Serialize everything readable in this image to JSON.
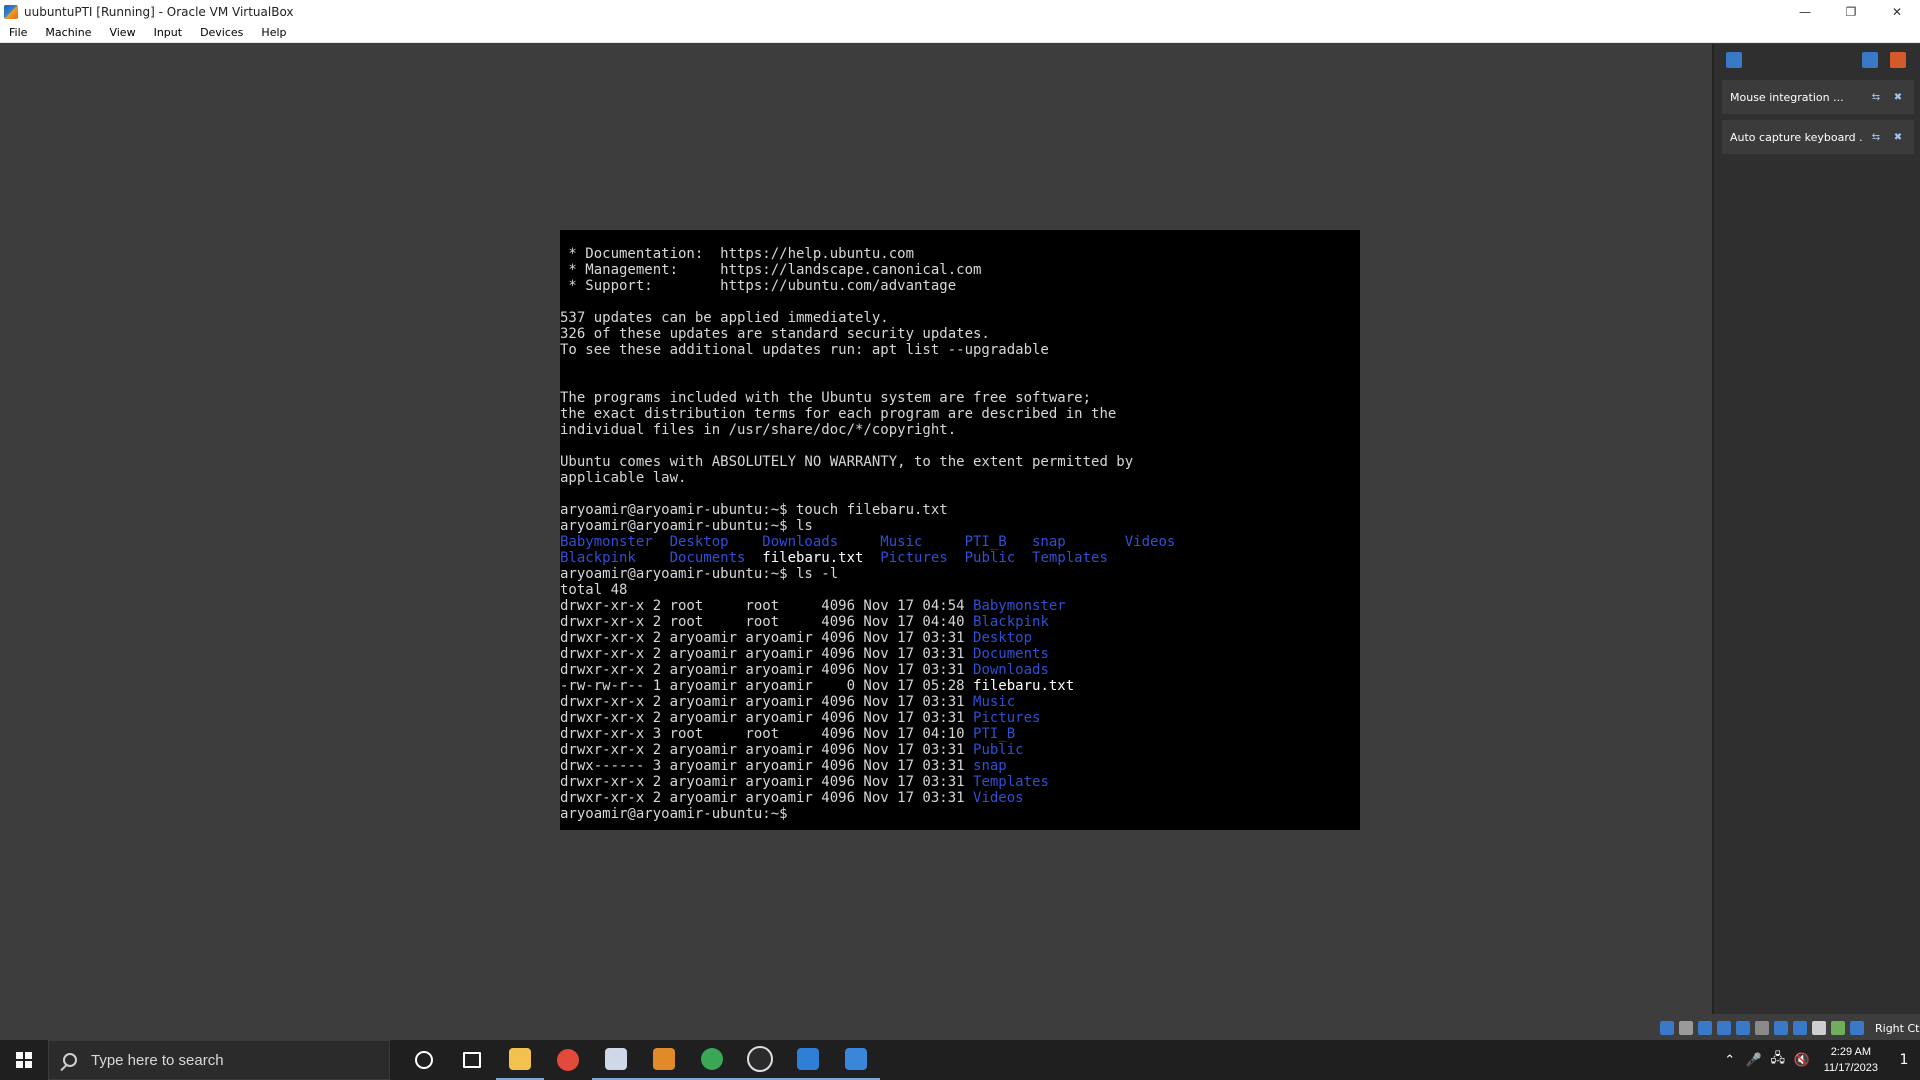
{
  "window": {
    "title": "uubuntuPTI [Running] - Oracle VM VirtualBox",
    "controls": {
      "minimize": "—",
      "restore": "❐",
      "close": "✕"
    }
  },
  "menu": {
    "items": [
      "File",
      "Machine",
      "View",
      "Input",
      "Devices",
      "Help"
    ]
  },
  "notifications": {
    "items": [
      {
        "text": "Mouse integration ...",
        "pin": "⇆",
        "close": "✖"
      },
      {
        "text": "Auto capture keyboard ...",
        "pin": "⇆",
        "close": "✖"
      }
    ]
  },
  "terminal": {
    "lines": [
      [
        {
          "t": " * Documentation:  https://help.ubuntu.com",
          "c": ""
        }
      ],
      [
        {
          "t": " * Management:     https://landscape.canonical.com",
          "c": ""
        }
      ],
      [
        {
          "t": " * Support:        https://ubuntu.com/advantage",
          "c": ""
        }
      ],
      [
        {
          "t": "",
          "c": ""
        }
      ],
      [
        {
          "t": "537 updates can be applied immediately.",
          "c": ""
        }
      ],
      [
        {
          "t": "326 of these updates are standard security updates.",
          "c": ""
        }
      ],
      [
        {
          "t": "To see these additional updates run: apt list --upgradable",
          "c": ""
        }
      ],
      [
        {
          "t": "",
          "c": ""
        }
      ],
      [
        {
          "t": "",
          "c": ""
        }
      ],
      [
        {
          "t": "The programs included with the Ubuntu system are free software;",
          "c": ""
        }
      ],
      [
        {
          "t": "the exact distribution terms for each program are described in the",
          "c": ""
        }
      ],
      [
        {
          "t": "individual files in /usr/share/doc/*/copyright.",
          "c": ""
        }
      ],
      [
        {
          "t": "",
          "c": ""
        }
      ],
      [
        {
          "t": "Ubuntu comes with ABSOLUTELY NO WARRANTY, to the extent permitted by",
          "c": ""
        }
      ],
      [
        {
          "t": "applicable law.",
          "c": ""
        }
      ],
      [
        {
          "t": "",
          "c": ""
        }
      ],
      [
        {
          "t": "aryoamir@aryoamir-ubuntu:~$ touch filebaru.txt",
          "c": ""
        }
      ],
      [
        {
          "t": "aryoamir@aryoamir-ubuntu:~$ ls",
          "c": ""
        }
      ],
      [
        {
          "t": "Babymonster  Desktop    Downloads     Music     PTI_B   snap       Videos",
          "c": "blue"
        }
      ],
      [
        {
          "t": "Blackpink    Documents  ",
          "c": "blue"
        },
        {
          "t": "filebaru.txt",
          "c": "white"
        },
        {
          "t": "  Pictures  Public  Templates",
          "c": "blue"
        }
      ],
      [
        {
          "t": "aryoamir@aryoamir-ubuntu:~$ ls -l",
          "c": ""
        }
      ],
      [
        {
          "t": "total 48",
          "c": ""
        }
      ],
      [
        {
          "t": "drwxr-xr-x 2 root     root     4096 Nov 17 04:54 ",
          "c": ""
        },
        {
          "t": "Babymonster",
          "c": "blue"
        }
      ],
      [
        {
          "t": "drwxr-xr-x 2 root     root     4096 Nov 17 04:40 ",
          "c": ""
        },
        {
          "t": "Blackpink",
          "c": "blue"
        }
      ],
      [
        {
          "t": "drwxr-xr-x 2 aryoamir aryoamir 4096 Nov 17 03:31 ",
          "c": ""
        },
        {
          "t": "Desktop",
          "c": "blue"
        }
      ],
      [
        {
          "t": "drwxr-xr-x 2 aryoamir aryoamir 4096 Nov 17 03:31 ",
          "c": ""
        },
        {
          "t": "Documents",
          "c": "blue"
        }
      ],
      [
        {
          "t": "drwxr-xr-x 2 aryoamir aryoamir 4096 Nov 17 03:31 ",
          "c": ""
        },
        {
          "t": "Downloads",
          "c": "blue"
        }
      ],
      [
        {
          "t": "-rw-rw-r-- 1 aryoamir aryoamir    0 Nov 17 05:28 ",
          "c": ""
        },
        {
          "t": "filebaru.txt",
          "c": "white"
        }
      ],
      [
        {
          "t": "drwxr-xr-x 2 aryoamir aryoamir 4096 Nov 17 03:31 ",
          "c": ""
        },
        {
          "t": "Music",
          "c": "blue"
        }
      ],
      [
        {
          "t": "drwxr-xr-x 2 aryoamir aryoamir 4096 Nov 17 03:31 ",
          "c": ""
        },
        {
          "t": "Pictures",
          "c": "blue"
        }
      ],
      [
        {
          "t": "drwxr-xr-x 3 root     root     4096 Nov 17 04:10 ",
          "c": ""
        },
        {
          "t": "PTI_B",
          "c": "blue"
        }
      ],
      [
        {
          "t": "drwxr-xr-x 2 aryoamir aryoamir 4096 Nov 17 03:31 ",
          "c": ""
        },
        {
          "t": "Public",
          "c": "blue"
        }
      ],
      [
        {
          "t": "drwx------ 3 aryoamir aryoamir 4096 Nov 17 03:31 ",
          "c": ""
        },
        {
          "t": "snap",
          "c": "blue"
        }
      ],
      [
        {
          "t": "drwxr-xr-x 2 aryoamir aryoamir 4096 Nov 17 03:31 ",
          "c": ""
        },
        {
          "t": "Templates",
          "c": "blue"
        }
      ],
      [
        {
          "t": "drwxr-xr-x 2 aryoamir aryoamir 4096 Nov 17 03:31 ",
          "c": ""
        },
        {
          "t": "Videos",
          "c": "blue"
        }
      ],
      [
        {
          "t": "aryoamir@aryoamir-ubuntu:~$",
          "c": ""
        }
      ]
    ]
  },
  "statusbar": {
    "right_ctrl_label": "Right Ctrl",
    "icon_colors": [
      "#3a78c8",
      "#9a9a9a",
      "#3a78c8",
      "#3a78c8",
      "#3a78c8",
      "#8a8a8a",
      "#3a78c8",
      "#3a78c8",
      "#cfcfcf",
      "#6fae5a",
      "#3a78c8"
    ]
  },
  "taskbar": {
    "search_placeholder": "Type here to search",
    "apps": [
      {
        "name": "cortana-icon",
        "color": "#1f1f1f",
        "active": false
      },
      {
        "name": "task-view-icon",
        "color": "#1f1f1f",
        "active": false
      },
      {
        "name": "file-explorer-icon",
        "color": "#f2c14e",
        "active": true
      },
      {
        "name": "chrome-icon",
        "color": "#e24a3b",
        "active": false
      },
      {
        "name": "virtualbox-cube-icon",
        "color": "#cfd8e8",
        "active": true
      },
      {
        "name": "virtualbox-icon",
        "color": "#e08a2a",
        "active": true
      },
      {
        "name": "chrome-profile-icon",
        "color": "#3aa757",
        "active": true
      },
      {
        "name": "obs-icon",
        "color": "#2b2b2b",
        "active": true
      },
      {
        "name": "media-player-icon",
        "color": "#2f7fd6",
        "active": true
      },
      {
        "name": "vm-window-icon",
        "color": "#3a86d8",
        "active": true
      }
    ],
    "tray": {
      "chevron": "⌃",
      "mic": "🎤",
      "network": "🖧",
      "volume": "🔇",
      "time": "2:29 AM",
      "date": "11/17/2023",
      "notification_count": "1"
    }
  }
}
